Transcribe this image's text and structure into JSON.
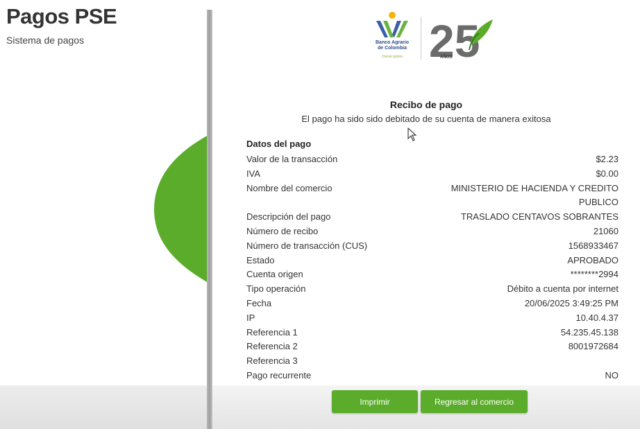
{
  "header": {
    "title": "Pagos PSE",
    "subtitle": "Sistema de pagos"
  },
  "logo": {
    "bank_name_line1": "Banco Agrario",
    "bank_name_line2": "de Colombia",
    "slogan": "Crecer juntos",
    "anniversary": "25",
    "anniversary_label": "AÑOS"
  },
  "receipt": {
    "title": "Recibo de pago",
    "message": "El pago ha sido sido debitado de su cuenta de manera exitosa",
    "section_title": "Datos del pago",
    "rows": [
      {
        "label": "Valor de la transacción",
        "value": "$2.23"
      },
      {
        "label": "IVA",
        "value": "$0.00"
      },
      {
        "label": "Nombre del comercio",
        "value": "MINISTERIO DE HACIENDA Y CREDITO PUBLICO"
      },
      {
        "label": "Descripción del pago",
        "value": "TRASLADO CENTAVOS SOBRANTES"
      },
      {
        "label": "Número de recibo",
        "value": "21060"
      },
      {
        "label": "Número de transacción (CUS)",
        "value": "1568933467"
      },
      {
        "label": "Estado",
        "value": "APROBADO"
      },
      {
        "label": "Cuenta origen",
        "value": "********2994"
      },
      {
        "label": "Tipo operación",
        "value": "Débito a cuenta por internet"
      },
      {
        "label": "Fecha",
        "value": "20/06/2025 3:49:25 PM"
      },
      {
        "label": "IP",
        "value": "10.40.4.37"
      },
      {
        "label": "Referencia 1",
        "value": "54.235.45.138"
      },
      {
        "label": "Referencia 2",
        "value": "8001972684"
      },
      {
        "label": "Referencia 3",
        "value": ""
      },
      {
        "label": "Pago recurrente",
        "value": "NO"
      }
    ]
  },
  "actions": {
    "print_label": "Imprimir",
    "return_label": "Regresar al comercio"
  },
  "colors": {
    "accent_green": "#5aac2a",
    "text": "#333333"
  }
}
